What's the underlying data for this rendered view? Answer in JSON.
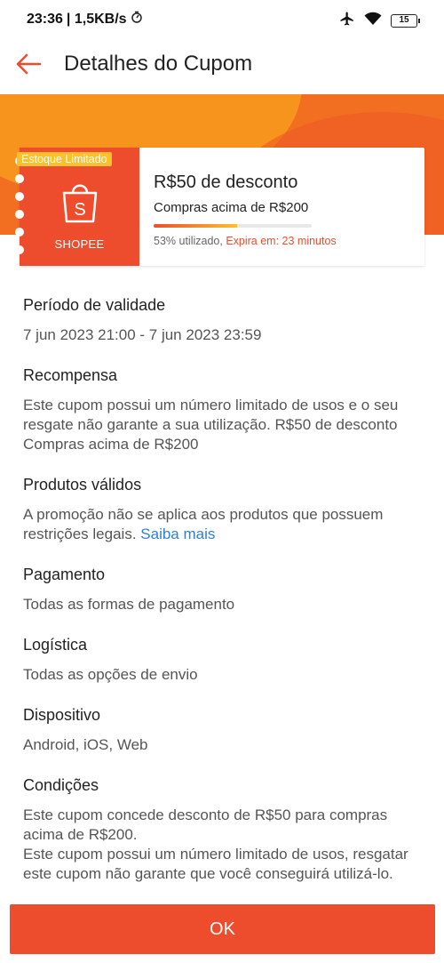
{
  "status_bar": {
    "time": "23:36",
    "speed": "| 1,5KB/s",
    "battery": "15"
  },
  "header": {
    "title": "Detalhes do Cupom"
  },
  "coupon": {
    "badge": "Estoque Limitado",
    "brand": "SHOPEE",
    "title": "R$50 de desconto",
    "subtitle": "Compras acima de R$200",
    "usage_percent": 53,
    "usage_text": "53% utilizado, ",
    "expire_text": "Expira em: 23 minutos"
  },
  "sections": [
    {
      "title": "Período de validade",
      "body": "7 jun 2023 21:00 - 7 jun 2023 23:59"
    },
    {
      "title": "Recompensa",
      "body": "Este cupom possui um número limitado de usos e o seu resgate não garante a sua utilização. R$50 de desconto Compras acima de R$200"
    },
    {
      "title": "Produtos válidos",
      "body": "A promoção não se aplica aos produtos que possuem restrições legais. ",
      "link": "Saiba mais"
    },
    {
      "title": "Pagamento",
      "body": "Todas as formas de pagamento"
    },
    {
      "title": "Logística",
      "body": "Todas as opções de envio"
    },
    {
      "title": "Dispositivo",
      "body": "Android, iOS, Web"
    },
    {
      "title": "Condições",
      "body": "Este cupom concede desconto de R$50 para compras acima de R$200.",
      "body2": "Este cupom possui um número limitado de usos, resgatar este cupom não garante que você conseguirá utilizá-lo."
    }
  ],
  "footer": {
    "ok_label": "OK"
  },
  "colors": {
    "brand": "#ee4d2d",
    "banner": "#f26f21",
    "link": "#2f7fd8",
    "badge": "#fbc02d"
  }
}
